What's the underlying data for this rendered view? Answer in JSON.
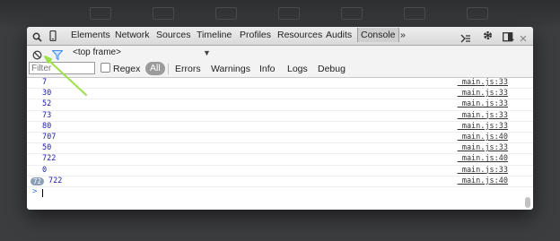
{
  "toolbar": {
    "tabs": [
      "Elements",
      "Network",
      "Sources",
      "Timeline",
      "Profiles",
      "Resources",
      "Audits",
      "Console"
    ],
    "active_tab": "Console",
    "more_label": "»"
  },
  "filters": {
    "frame_label": "<top frame>",
    "filter_placeholder": "Filter",
    "regex_label": "Regex",
    "levels": [
      "All",
      "Errors",
      "Warnings",
      "Info",
      "Logs",
      "Debug"
    ],
    "active_level": "All"
  },
  "log": [
    {
      "value": "7",
      "source": "_main.js:33"
    },
    {
      "value": "30",
      "source": "_main.js:33"
    },
    {
      "value": "52",
      "source": "_main.js:33"
    },
    {
      "value": "73",
      "source": "_main.js:33"
    },
    {
      "value": "80",
      "source": "_main.js:33"
    },
    {
      "value": "707",
      "source": "_main.js:40"
    },
    {
      "value": "50",
      "source": "_main.js:33"
    },
    {
      "value": "722",
      "source": "_main.js:40"
    },
    {
      "value": "0",
      "source": "_main.js:33"
    },
    {
      "value": "722",
      "source": "_main.js:40",
      "badge": "72"
    }
  ],
  "prompt": {
    "symbol": ">"
  },
  "colors": {
    "log_value": "#1a1aa6",
    "prompt": "#367cf1",
    "annotation_arrow": "#9be04a",
    "filter_icon": "#3b8cf7"
  }
}
